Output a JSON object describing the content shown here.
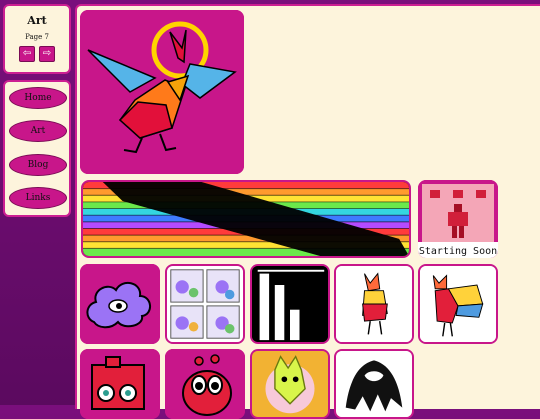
{
  "nav": {
    "section_title": "Art",
    "page_label": "Page 7",
    "prev_icon": "left-arrow-icon",
    "next_icon": "right-arrow-icon",
    "prev_glyph": "⇦",
    "next_glyph": "⇨"
  },
  "links": [
    {
      "label": "Home"
    },
    {
      "label": "Art"
    },
    {
      "label": "Blog"
    },
    {
      "label": "Links"
    }
  ],
  "gallery": {
    "banner_tile_text": "Starting Soon",
    "tiles": [
      "bird-headdress-artwork",
      "rainbow-brick-banner-artwork",
      "starting-soon-pixel-artwork",
      "purple-cloud-creature-artwork",
      "comic-page-artwork",
      "bar-graphic-artwork",
      "red-bird-sketch-artwork",
      "rainbow-bird-artwork",
      "red-box-creature-artwork",
      "red-bug-creature-artwork",
      "yellow-cat-artwork",
      "black-white-creature-artwork"
    ]
  },
  "colors": {
    "accent": "#c8168a",
    "panel": "#fdf4dc",
    "background": "#6a0b6e"
  }
}
